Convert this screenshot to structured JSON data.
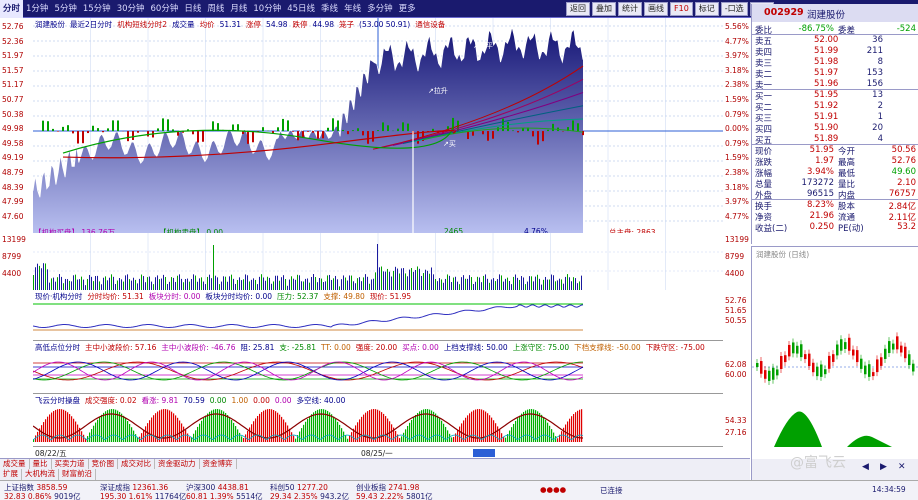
{
  "toolbar": {
    "period_tabs": [
      "分时",
      "1分钟",
      "5分钟",
      "15分钟",
      "30分钟",
      "60分钟",
      "日线",
      "周线",
      "月线",
      "10分钟",
      "45日线",
      "季线",
      "年线",
      "多分钟",
      "更多"
    ],
    "active_index": 0,
    "right_tools": [
      "返回",
      "叠加",
      "统计",
      "画线",
      "F10",
      "标记",
      "-口选",
      "复归"
    ]
  },
  "main_panel": {
    "title": [
      "润建股份",
      "最近2日分时",
      "机构短线分时2",
      "成交量",
      "均价",
      "51.31",
      "涨停",
      "54.98",
      "跌停",
      "44.98",
      "笼子",
      "(53.00 50.91)",
      "通信设备"
    ],
    "left_labels": [
      "52.76",
      "52.36",
      "51.97",
      "51.57",
      "51.17",
      "50.77",
      "50.38",
      "49.98",
      "49.58",
      "49.19",
      "48.79",
      "48.39",
      "47.99",
      "47.60"
    ],
    "right_labels": [
      "5.56%",
      "4.77%",
      "3.97%",
      "3.18%",
      "2.38%",
      "1.59%",
      "0.79%",
      "0.00%",
      "0.79%",
      "1.59%",
      "2.38%",
      "3.18%",
      "3.97%",
      "4.77%"
    ],
    "price_low": 47.6,
    "price_high": 52.76,
    "prev_close": 49.98,
    "annotations": [
      "↗短平",
      "↗拉升",
      "↗买"
    ],
    "legend": [
      {
        "label": "【机构买盘】",
        "value": "136.76万"
      },
      {
        "label": "【机构卖盘】",
        "value": "0.00"
      },
      {
        "label": "",
        "value": "2465"
      },
      {
        "label": "",
        "value": "4.76%"
      },
      {
        "label": "总主盘:",
        "value": "2863"
      }
    ]
  },
  "volume_panel": {
    "left_labels": [
      "13199",
      "8799",
      "4400"
    ],
    "right_labels": [
      "13199",
      "8799",
      "4400"
    ]
  },
  "indicator1": {
    "title": "现价·机构分时",
    "items": [
      "分时均价: 51.31",
      "板块分时: 0.00",
      "板块分时均价: 0.00",
      "压力: 52.37",
      "支撑: 49.80",
      "现价: 51.95"
    ],
    "right_labels": [
      "52.76",
      "51.65",
      "50.55"
    ]
  },
  "indicator2": {
    "title": "高低点位分时",
    "items": [
      "主中小波段价: 57.16",
      "主中小波段价: -46.76",
      "阻: 25.81",
      "支: -25.81",
      "TT: 0.00",
      "强度: 20.00",
      "买点: 0.00",
      "上档支撑线: 50.00",
      "上涨守区: 75.00",
      "下档支撑线: -50.00",
      "下跌守区: -75.00"
    ],
    "right_labels": [
      "62.08",
      "60.00"
    ]
  },
  "indicator3": {
    "title": "飞云分时操盘",
    "items": [
      "成交强度: 0.02",
      "看涨: 9.81",
      "70.59",
      "0.00",
      "1.00",
      "0.00",
      "0.00",
      "多空线: 40.00"
    ],
    "right_labels": [
      "54.33",
      "27.16"
    ]
  },
  "date_axis": {
    "left": "08/22/五",
    "middle": "08/25/一"
  },
  "bottom_tabs": [
    "成交量",
    "量比",
    "买卖力道",
    "竞价图",
    "成交对比",
    "资金驱动力",
    "资金博弈"
  ],
  "bottom_tabs2": [
    "扩展",
    "大机构流",
    "财富前沿"
  ],
  "status_bar": {
    "indices": [
      {
        "name": "上证指数",
        "value": "3858.59",
        "change": "32.83",
        "pct": "0.86%",
        "amount": "9019亿"
      },
      {
        "name": "深证成指",
        "value": "12361.36",
        "change": "195.30",
        "pct": "1.61%",
        "amount": "11764亿"
      },
      {
        "name": "沪深300",
        "value": "4438.81",
        "change": "60.81",
        "pct": "1.39%",
        "amount": "5514亿"
      },
      {
        "name": "科创50",
        "value": "1277.20",
        "change": "29.34",
        "pct": "2.35%",
        "amount": "943.2亿"
      },
      {
        "name": "创业板指",
        "value": "2741.98",
        "change": "59.43",
        "pct": "2.22%",
        "amount": "5801亿"
      }
    ],
    "conn": "已连接",
    "time": "14:34:59"
  },
  "quote": {
    "code": "002929",
    "name": "润建股份",
    "webi": {
      "label": "委比",
      "pct": "-86.75%",
      "label2": "委差",
      "diff": "-524"
    },
    "asks": [
      {
        "label": "卖五",
        "price": "52.00",
        "vol": "36"
      },
      {
        "label": "卖四",
        "price": "51.99",
        "vol": "211"
      },
      {
        "label": "卖三",
        "price": "51.98",
        "vol": "8"
      },
      {
        "label": "卖二",
        "price": "51.97",
        "vol": "153"
      },
      {
        "label": "卖一",
        "price": "51.96",
        "vol": "156"
      }
    ],
    "bids": [
      {
        "label": "买一",
        "price": "51.95",
        "vol": "13"
      },
      {
        "label": "买二",
        "price": "51.92",
        "vol": "2"
      },
      {
        "label": "买三",
        "price": "51.91",
        "vol": "1"
      },
      {
        "label": "买四",
        "price": "51.90",
        "vol": "20"
      },
      {
        "label": "买五",
        "price": "51.89",
        "vol": "4"
      }
    ],
    "stats": [
      {
        "l1": "现价",
        "v1": "51.95",
        "l2": "今开",
        "v2": "50.56"
      },
      {
        "l1": "涨跌",
        "v1": "1.97",
        "l2": "最高",
        "v2": "52.76"
      },
      {
        "l1": "涨幅",
        "v1": "3.94%",
        "l2": "最低",
        "v2": "49.60"
      },
      {
        "l1": "总量",
        "v1": "173272",
        "l2": "量比",
        "v2": "2.10"
      },
      {
        "l1": "外盘",
        "v1": "96515",
        "l2": "内盘",
        "v2": "76757"
      }
    ],
    "stats2": [
      {
        "l1": "换手",
        "v1": "8.23%",
        "l2": "股本",
        "v2": "2.84亿"
      },
      {
        "l1": "净资",
        "v1": "21.96",
        "l2": "流通",
        "v2": "2.11亿"
      },
      {
        "l1": "收益(二)",
        "v1": "0.250",
        "l2": "PE(动)",
        "v2": "53.2"
      }
    ]
  },
  "mini_chart": {
    "title": "润建股份 (日线)"
  },
  "watermark": "@富飞云"
}
